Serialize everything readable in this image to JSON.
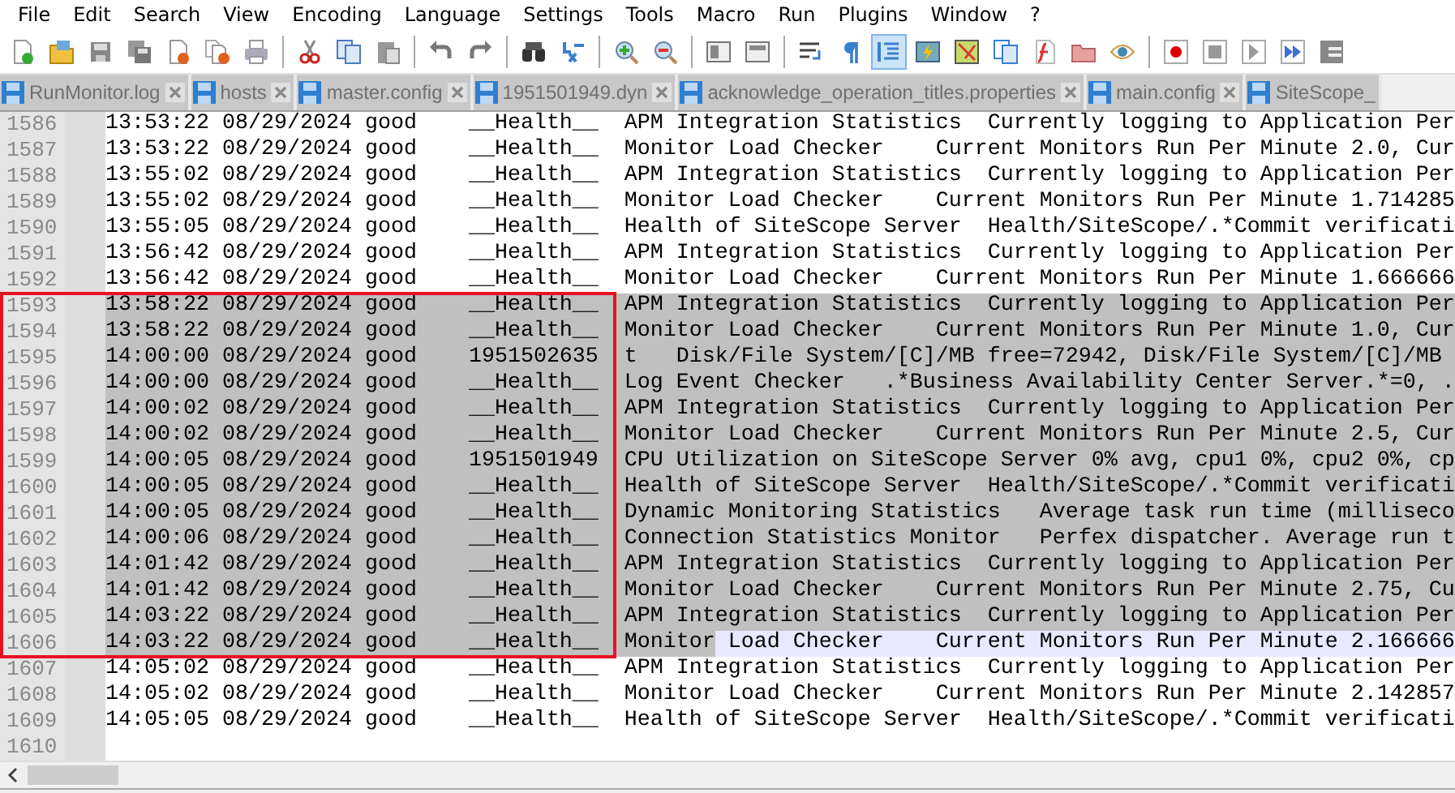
{
  "menu": [
    "File",
    "Edit",
    "Search",
    "View",
    "Encoding",
    "Language",
    "Settings",
    "Tools",
    "Macro",
    "Run",
    "Plugins",
    "Window",
    "?"
  ],
  "toolbar": [
    [
      {
        "kind": "newfile",
        "pressed": false
      },
      {
        "kind": "open",
        "pressed": false
      },
      {
        "kind": "save",
        "pressed": false
      },
      {
        "kind": "saveall",
        "pressed": false
      },
      {
        "kind": "close",
        "pressed": false
      },
      {
        "kind": "closeall",
        "pressed": false
      },
      {
        "kind": "print",
        "pressed": false
      }
    ],
    [
      {
        "kind": "cut",
        "pressed": false
      },
      {
        "kind": "copy",
        "pressed": false
      },
      {
        "kind": "paste",
        "pressed": false
      }
    ],
    [
      {
        "kind": "undo",
        "pressed": false
      },
      {
        "kind": "redo",
        "pressed": false
      }
    ],
    [
      {
        "kind": "find",
        "pressed": false
      },
      {
        "kind": "replace",
        "pressed": false
      }
    ],
    [
      {
        "kind": "zoomin",
        "pressed": false
      },
      {
        "kind": "zoomout",
        "pressed": false
      }
    ],
    [
      {
        "kind": "syncv",
        "pressed": false
      },
      {
        "kind": "synch",
        "pressed": false
      }
    ],
    [
      {
        "kind": "wrap",
        "pressed": false
      },
      {
        "kind": "pilcrow",
        "pressed": false
      },
      {
        "kind": "indent",
        "pressed": true
      },
      {
        "kind": "udl",
        "pressed": false
      },
      {
        "kind": "docmap",
        "pressed": false
      },
      {
        "kind": "doclist",
        "pressed": false
      },
      {
        "kind": "funclist",
        "pressed": false
      },
      {
        "kind": "folder",
        "pressed": false
      },
      {
        "kind": "eye",
        "pressed": false
      }
    ],
    [
      {
        "kind": "record",
        "pressed": false
      },
      {
        "kind": "stop",
        "pressed": false
      },
      {
        "kind": "play",
        "pressed": false
      },
      {
        "kind": "playmulti",
        "pressed": false
      },
      {
        "kind": "savemacro",
        "pressed": false
      }
    ]
  ],
  "tabs": [
    {
      "label": "RunMonitor.log",
      "selected": false
    },
    {
      "label": "hosts",
      "selected": false
    },
    {
      "label": "master.config",
      "selected": false
    },
    {
      "label": "1951501949.dyn",
      "selected": false
    },
    {
      "label": "acknowledge_operation_titles.properties",
      "selected": false
    },
    {
      "label": "main.config",
      "selected": false
    },
    {
      "label": "SiteScope_",
      "selected": false,
      "cut": true
    }
  ],
  "lines": [
    {
      "number": "1586",
      "text": "13:53:22 08/29/2024 good    __Health__  APM Integration Statistics  Currently logging to Application Per",
      "selected": false,
      "current": false
    },
    {
      "number": "1587",
      "text": "13:53:22 08/29/2024 good    __Health__  Monitor Load Checker    Current Monitors Run Per Minute 2.0, Cur",
      "selected": false,
      "current": false
    },
    {
      "number": "1588",
      "text": "13:55:02 08/29/2024 good    __Health__  APM Integration Statistics  Currently logging to Application Per",
      "selected": false,
      "current": false
    },
    {
      "number": "1589",
      "text": "13:55:02 08/29/2024 good    __Health__  Monitor Load Checker    Current Monitors Run Per Minute 1.714285",
      "selected": false,
      "current": false
    },
    {
      "number": "1590",
      "text": "13:55:05 08/29/2024 good    __Health__  Health of SiteScope Server  Health/SiteScope/.*Commit verificati",
      "selected": false,
      "current": false
    },
    {
      "number": "1591",
      "text": "13:56:42 08/29/2024 good    __Health__  APM Integration Statistics  Currently logging to Application Per",
      "selected": false,
      "current": false
    },
    {
      "number": "1592",
      "text": "13:56:42 08/29/2024 good    __Health__  Monitor Load Checker    Current Monitors Run Per Minute 1.666666",
      "selected": false,
      "current": false
    },
    {
      "number": "1593",
      "text": "13:58:22 08/29/2024 good    __Health__  APM Integration Statistics  Currently logging to Application Per",
      "selected": true,
      "current": false
    },
    {
      "number": "1594",
      "text": "13:58:22 08/29/2024 good    __Health__  Monitor Load Checker    Current Monitors Run Per Minute 1.0, Cur",
      "selected": true,
      "current": false
    },
    {
      "number": "1595",
      "text": "14:00:00 08/29/2024 good    1951502635  t   Disk/File System/[C]/MB free=72942, Disk/File System/[C]/MB",
      "selected": true,
      "current": false
    },
    {
      "number": "1596",
      "text": "14:00:00 08/29/2024 good    __Health__  Log Event Checker   .*Business Availability Center Server.*=0, .",
      "selected": true,
      "current": false
    },
    {
      "number": "1597",
      "text": "14:00:02 08/29/2024 good    __Health__  APM Integration Statistics  Currently logging to Application Per",
      "selected": true,
      "current": false
    },
    {
      "number": "1598",
      "text": "14:00:02 08/29/2024 good    __Health__  Monitor Load Checker    Current Monitors Run Per Minute 2.5, Cur",
      "selected": true,
      "current": false
    },
    {
      "number": "1599",
      "text": "14:00:05 08/29/2024 good    1951501949  CPU Utilization on SiteScope Server 0% avg, cpu1 0%, cpu2 0%, cp",
      "selected": true,
      "current": false
    },
    {
      "number": "1600",
      "text": "14:00:05 08/29/2024 good    __Health__  Health of SiteScope Server  Health/SiteScope/.*Commit verificati",
      "selected": true,
      "current": false
    },
    {
      "number": "1601",
      "text": "14:00:05 08/29/2024 good    __Health__  Dynamic Monitoring Statistics   Average task run time (milliseco",
      "selected": true,
      "current": false
    },
    {
      "number": "1602",
      "text": "14:00:06 08/29/2024 good    __Health__  Connection Statistics Monitor   Perfex dispatcher. Average run t",
      "selected": true,
      "current": false
    },
    {
      "number": "1603",
      "text": "14:01:42 08/29/2024 good    __Health__  APM Integration Statistics  Currently logging to Application Per",
      "selected": true,
      "current": false
    },
    {
      "number": "1604",
      "text": "14:01:42 08/29/2024 good    __Health__  Monitor Load Checker    Current Monitors Run Per Minute 2.75, Cu",
      "selected": true,
      "current": false
    },
    {
      "number": "1605",
      "text": "14:03:22 08/29/2024 good    __Health__  APM Integration Statistics  Currently logging to Application Per",
      "selected": true,
      "current": false
    },
    {
      "number": "1606",
      "text": "14:03:22 08/29/2024 good    __Health__  Monitor Load Checker    Current Monitors Run Per Minute 2.166666",
      "selected": true,
      "current": true
    },
    {
      "number": "1607",
      "text": "14:05:02 08/29/2024 good    __Health__  APM Integration Statistics  Currently logging to Application Per",
      "selected": false,
      "current": false
    },
    {
      "number": "1608",
      "text": "14:05:02 08/29/2024 good    __Health__  Monitor Load Checker    Current Monitors Run Per Minute 2.142857",
      "selected": false,
      "current": false
    },
    {
      "number": "1609",
      "text": "14:05:05 08/29/2024 good    __Health__  Health of SiteScope Server  Health/SiteScope/.*Commit verificati",
      "selected": false,
      "current": false
    },
    {
      "number": "1610",
      "selected": false,
      "current": false
    }
  ]
}
